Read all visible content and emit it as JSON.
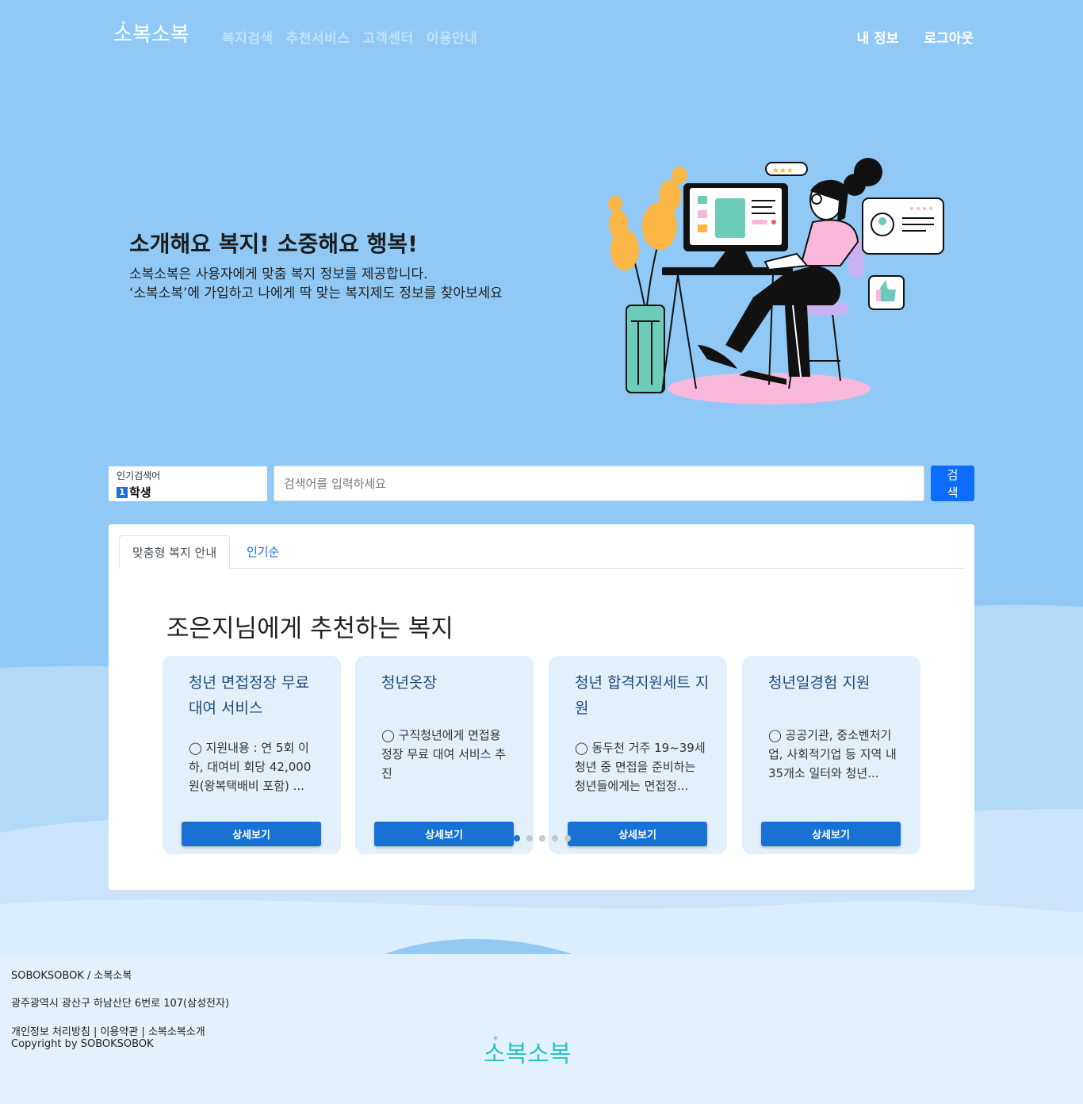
{
  "header": {
    "logo_text": "소복소복",
    "nav": [
      "복지검색",
      "추천서비스",
      "고객센터",
      "이용안내"
    ],
    "my_info": "내 정보",
    "logout": "로그아웃"
  },
  "hero": {
    "title": "소개해요 복지! 소중해요 행복!",
    "line1": "소복소복은 사용자에게 맞춤 복지 정보를 제공합니다.",
    "line2": "‘소복소복’에 가입하고 나에게 딱 맞는 복지제도 정보를 찾아보세요"
  },
  "search": {
    "popular_label": "인기검색어",
    "popular_rank": "1",
    "popular_word": "학생",
    "placeholder": "검색어를 입력하세요",
    "button": "검색"
  },
  "tabs": [
    "맞춤형 복지 안내",
    "인기순"
  ],
  "recommend_title": "조은지님에게 추천하는 복지",
  "cards": [
    {
      "title": "청년 면접정장 무료 대여 서비스",
      "desc": "◯ 지원내용 : 연 5회 이하, 대여비 회당 42,000원(왕복택배비 포함) ...",
      "button": "상세보기"
    },
    {
      "title": "청년옷장",
      "desc": "◯ 구직청년에게 면접용 정장 무료 대여 서비스 추진",
      "button": "상세보기"
    },
    {
      "title": "청년 합격지원세트 지원",
      "desc": "◯ 동두천 거주 19~39세 청년 중 면접을 준비하는 청년들에게는 면접정...",
      "button": "상세보기"
    },
    {
      "title": "청년일경험 지원",
      "desc": "◯ 공공기관, 중소벤처기업, 사회적기업 등 지역 내 35개소 일터와 청년...",
      "button": "상세보기"
    }
  ],
  "carousel": {
    "total": 5,
    "active": 1
  },
  "footer": {
    "brand": "SOBOKSOBOK / 소복소복",
    "address": "광주광역시 광산구 하남산단 6번로 107(삼성전자)",
    "links": "개인정보 처리방침 | 이용약관 | 소복소복소개",
    "copyright": "Copyright by SOBOKSOBOK",
    "logo_text": "소복소복"
  },
  "colors": {
    "sky": "#90c9f5",
    "accent": "#0d6efd",
    "card_bg": "#e2f0fc",
    "footer_bg": "#e3f1fd",
    "logo_teal": "#2ec4c4"
  }
}
